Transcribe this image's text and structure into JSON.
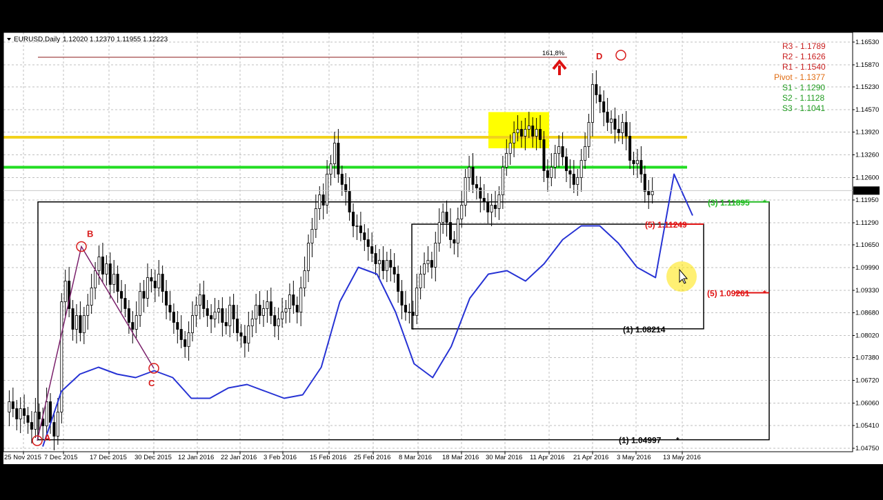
{
  "window": {
    "symbol_label": "EURUSD,Daily",
    "ohlc_label": "1.12020 1.12370 1.11955 1.12223",
    "current_price_tag": "1.12223"
  },
  "chart_data": {
    "type": "candlestick",
    "instrument": "EURUSD",
    "timeframe": "Daily",
    "ylim": [
      1.0475,
      1.1675
    ],
    "grid": true,
    "x_tick_labels": [
      "25 Nov 2015",
      "7 Dec 2015",
      "17 Dec 2015",
      "30 Dec 2015",
      "12 Jan 2016",
      "22 Jan 2016",
      "3 Feb 2016",
      "15 Feb 2016",
      "25 Feb 2016",
      "8 Mar 2016",
      "18 Mar 2016",
      "30 Mar 2016",
      "11 Apr 2016",
      "21 Apr 2016",
      "3 May 2016",
      "13 May 2016"
    ],
    "y_tick_labels": [
      1.1653,
      1.1587,
      1.1523,
      1.1457,
      1.1392,
      1.1326,
      1.126,
      1.1195,
      1.1129,
      1.1065,
      1.0999,
      1.0933,
      1.0868,
      1.0802,
      1.0738,
      1.0672,
      1.0606,
      1.0541,
      1.0475
    ],
    "close_series": [
      1.058,
      1.061,
      1.059,
      1.056,
      1.059,
      1.057,
      1.055,
      1.053,
      1.058,
      1.056,
      1.054,
      1.061,
      1.055,
      1.051,
      1.058,
      1.09,
      1.096,
      1.088,
      1.082,
      1.086,
      1.081,
      1.086,
      1.089,
      1.094,
      1.099,
      1.103,
      1.098,
      1.101,
      1.095,
      1.098,
      1.093,
      1.091,
      1.088,
      1.084,
      1.082,
      1.086,
      1.093,
      1.091,
      1.097,
      1.096,
      1.094,
      1.098,
      1.093,
      1.089,
      1.087,
      1.084,
      1.082,
      1.079,
      1.077,
      1.081,
      1.086,
      1.089,
      1.092,
      1.088,
      1.086,
      1.085,
      1.087,
      1.088,
      1.084,
      1.083,
      1.089,
      1.085,
      1.081,
      1.08,
      1.078,
      1.083,
      1.085,
      1.089,
      1.086,
      1.088,
      1.09,
      1.086,
      1.083,
      1.085,
      1.087,
      1.088,
      1.092,
      1.089,
      1.087,
      1.094,
      1.099,
      1.107,
      1.111,
      1.117,
      1.121,
      1.118,
      1.127,
      1.13,
      1.136,
      1.127,
      1.124,
      1.122,
      1.116,
      1.112,
      1.112,
      1.11,
      1.108,
      1.106,
      1.104,
      1.101,
      1.102,
      1.099,
      1.102,
      1.1,
      1.098,
      1.093,
      1.089,
      1.087,
      1.087,
      1.086,
      1.094,
      1.098,
      1.101,
      1.102,
      1.1,
      1.107,
      1.113,
      1.116,
      1.113,
      1.108,
      1.107,
      1.114,
      1.118,
      1.126,
      1.129,
      1.124,
      1.123,
      1.12,
      1.119,
      1.116,
      1.118,
      1.117,
      1.121,
      1.129,
      1.133,
      1.136,
      1.139,
      1.14,
      1.138,
      1.14,
      1.141,
      1.138,
      1.14,
      1.137,
      1.128,
      1.126,
      1.129,
      1.133,
      1.135,
      1.132,
      1.128,
      1.127,
      1.124,
      1.126,
      1.131,
      1.135,
      1.142,
      1.153,
      1.15,
      1.148,
      1.145,
      1.142,
      1.143,
      1.14,
      1.139,
      1.142,
      1.138,
      1.131,
      1.13,
      1.131,
      1.127,
      1.122,
      1.121,
      1.122
    ],
    "moving_average": {
      "color": "#2632d4",
      "start_date": "7 Dec 2015",
      "values": [
        1.048,
        1.064,
        1.069,
        1.071,
        1.069,
        1.068,
        1.07,
        1.068,
        1.062,
        1.062,
        1.065,
        1.066,
        1.064,
        1.062,
        1.063,
        1.071,
        1.09,
        1.1,
        1.098,
        1.087,
        1.072,
        1.068,
        1.077,
        1.091,
        1.098,
        1.099,
        1.096,
        1.101,
        1.108,
        1.112,
        1.112,
        1.107,
        1.1,
        1.097,
        1.127,
        1.115
      ]
    },
    "horizontal_lines": [
      {
        "value": 1.1377,
        "color": "#f2d21c"
      },
      {
        "value": 1.129,
        "color": "#22dd22"
      }
    ],
    "resistance_box": {
      "from": "30 Mar 2016",
      "to": "11 Apr 2016",
      "low": 1.1345,
      "high": 1.145,
      "color": "#ffff00"
    },
    "abcd_pattern": [
      {
        "label": "A",
        "date": "25 Nov 2015",
        "price": 1.0497
      },
      {
        "label": "B",
        "date": "7 Dec 2015",
        "price": 1.106
      },
      {
        "label": "C",
        "date": "30 Dec 2015",
        "price": 1.0707
      },
      {
        "label": "D",
        "date": "3 May 2016",
        "price": 1.1615
      }
    ],
    "pivot_levels": [
      {
        "label": "R3",
        "value": "1.1789",
        "color": "#c81e1e"
      },
      {
        "label": "R2",
        "value": "1.1626",
        "color": "#c81e1e"
      },
      {
        "label": "R1",
        "value": "1.1540",
        "color": "#c81e1e"
      },
      {
        "label": "Pivot",
        "value": "1.1377",
        "color": "#e06b10"
      },
      {
        "label": "S1",
        "value": "1.1290",
        "color": "#1f9b1f"
      },
      {
        "label": "S2",
        "value": "1.1128",
        "color": "#1f9b1f"
      },
      {
        "label": "S3",
        "value": "1.1041",
        "color": "#1f9b1f"
      }
    ],
    "annotations": {
      "fib_label": "161,8%",
      "fib_value": 1.1609,
      "level_3": {
        "text": "(3)  1.11895",
        "value": 1.11895,
        "color": "#22bb22"
      },
      "level_5a": {
        "text": "(5)  1.11249",
        "value": 1.11249,
        "color": "#e01010"
      },
      "level_5b": {
        "text": "(5)  1.09261",
        "value": 1.09261,
        "color": "#e01010"
      },
      "level_1a": {
        "text": "(1)  1.08214",
        "value": 1.08214,
        "color": "#000000"
      },
      "level_1b": {
        "text": "(1)  1.04997",
        "value": 1.04997,
        "color": "#000000"
      },
      "star": "*"
    }
  }
}
